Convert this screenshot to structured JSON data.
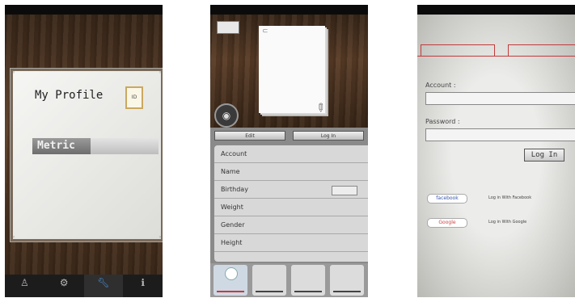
{
  "phone1": {
    "status": {
      "carrier": "",
      "right": ""
    },
    "title": "My Profile",
    "idcard_text": "ID",
    "metric_label": "Metric",
    "tabs": [
      {
        "icon": "person-icon",
        "label": ""
      },
      {
        "icon": "gear-icon",
        "label": ""
      },
      {
        "icon": "wrench-icon",
        "label": ""
      },
      {
        "icon": "info-icon",
        "label": ""
      }
    ]
  },
  "phone2": {
    "status": {
      "carrier": "",
      "right": ""
    },
    "back_label": "",
    "buttons": {
      "left": "Edit",
      "right": "Log In"
    },
    "fields": [
      {
        "label": "Account",
        "value": ""
      },
      {
        "label": "Name",
        "value": ""
      },
      {
        "label": "Birthday",
        "value": ""
      },
      {
        "label": "Weight",
        "value": ""
      },
      {
        "label": "Gender",
        "value": ""
      },
      {
        "label": "Height",
        "value": ""
      }
    ],
    "bottom_tab_label": ""
  },
  "phone3": {
    "status": {
      "carrier": "",
      "right": ""
    },
    "tabs": [
      "",
      ""
    ],
    "account_label": "Account :",
    "password_label": "Password :",
    "login_label": "Log In",
    "facebook_btn": "facebook",
    "facebook_text": "Log in With Facebook",
    "google_btn": "Google",
    "google_text": "Log in With Google"
  }
}
